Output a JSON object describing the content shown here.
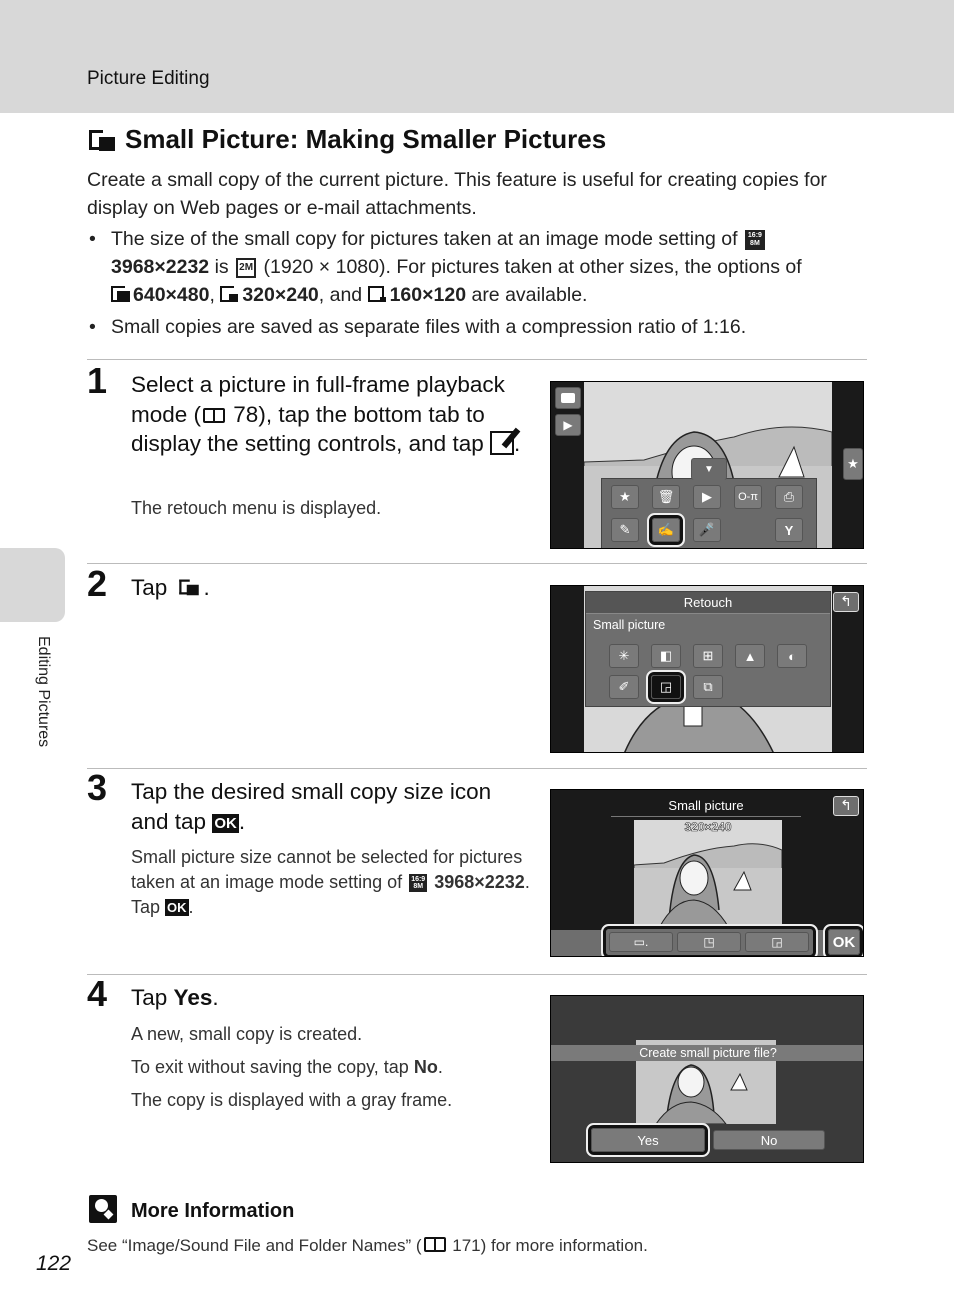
{
  "header": {
    "section": "Picture Editing"
  },
  "side_tab": {
    "label": "Editing Pictures"
  },
  "title": "Small Picture: Making Smaller Pictures",
  "intro": "Create a small copy of the current picture. This feature is useful for creating copies for display on Web pages or e-mail attachments.",
  "bullets": {
    "b1": {
      "t1": "The size of the small copy for pictures taken at an image mode setting of",
      "mode_icon": "16:9 8M",
      "mode": "3968×2232",
      "t2": "is",
      "copy_icon": "2M",
      "t3": "(1920 × 1080). For pictures taken at other sizes, the options of",
      "size1": "640×480",
      "sep1": ",",
      "size2": "320×240",
      "sep2": ", and",
      "size3": "160×120",
      "t4": "are available."
    },
    "b2": "Small copies are saved as separate files with a compression ratio of 1:16."
  },
  "steps": [
    {
      "number": "1",
      "title_a": "Select a picture in full-frame playback mode (",
      "page_ref": "78",
      "title_b": "), tap the bottom tab to display the setting controls, and tap",
      "title_end": ".",
      "note": "The retouch menu is displayed.",
      "screen": {
        "left_icons": [
          "camera-icon",
          "play-icon"
        ],
        "right_icon": "★",
        "menu_row1": [
          "favorites-icon",
          "delete-icon",
          "slideshow-icon",
          "protect-icon",
          "print-order-icon"
        ],
        "menu_row2": [
          "draw-icon",
          "retouch-icon",
          "voice-memo-icon",
          "",
          "setup-icon"
        ],
        "selected": "retouch-icon"
      }
    },
    {
      "number": "2",
      "title": "Tap",
      "title_end": ".",
      "screen": {
        "panel_title": "Retouch",
        "panel_sub": "Small picture",
        "row1": [
          "quick-retouch-icon",
          "d-lighting-icon",
          "skin-softening-icon",
          "filter-effects-icon",
          "glamour-icon"
        ],
        "row2": [
          "paint-icon",
          "small-picture-icon",
          "crop-icon"
        ],
        "selected": "small-picture-icon"
      }
    },
    {
      "number": "3",
      "title_a": "Tap the desired small copy size icon and tap",
      "ok": "OK",
      "title_end": ".",
      "note_a": "Small picture size cannot be selected for pictures taken at an image mode setting of",
      "note_mode_icon": "16:9 8M",
      "note_mode": "3968×2232",
      "note_b": ". Tap",
      "note_ok": "OK",
      "note_end": ".",
      "screen": {
        "title": "Small picture",
        "size_readout": "320×240",
        "size_buttons": [
          "160×120",
          "320×240",
          "640×480"
        ],
        "ok_label": "OK"
      }
    },
    {
      "number": "4",
      "title_a": "Tap",
      "title_bold": "Yes",
      "title_end": ".",
      "notes": [
        "A new, small copy is created.",
        "The copy is displayed with a gray frame."
      ],
      "note_no_a": "To exit without saving the copy, tap",
      "note_no_bold": "No",
      "note_no_end": ".",
      "screen": {
        "question": "Create small picture file?",
        "yes": "Yes",
        "no": "No"
      }
    }
  ],
  "more_info": {
    "title": "More Information",
    "text_a": "See “Image/Sound File and Folder Names” (",
    "page_ref": "171",
    "text_b": ") for more information."
  },
  "page_number": "122"
}
